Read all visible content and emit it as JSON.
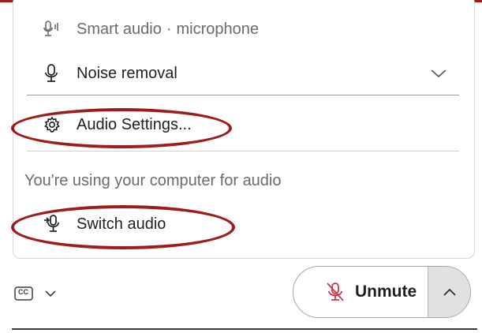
{
  "colors": {
    "highlight": "#a01c1c",
    "strip": "#a01c1c",
    "muted_icon": "#d0354a",
    "text_primary": "#1f1f1f",
    "text_secondary": "#6b6b6b"
  },
  "audio_menu": {
    "smart_audio": {
      "label": "Smart audio",
      "separator": "·",
      "mode": "microphone",
      "icon": "smart-microphone-icon"
    },
    "noise_removal": {
      "label": "Noise removal",
      "icon": "microphone-icon",
      "dropdown_icon": "chevron-down-icon"
    },
    "audio_settings": {
      "label": "Audio Settings...",
      "icon": "gear-icon"
    },
    "status_text": "You're using your computer for audio",
    "switch_audio": {
      "label": "Switch audio",
      "icon": "switch-audio-icon"
    }
  },
  "toolbar": {
    "captions": {
      "icon": "closed-captions-icon",
      "badge": "CC",
      "dropdown_icon": "chevron-down-icon"
    },
    "unmute": {
      "label": "Unmute",
      "icon": "muted-microphone-icon",
      "dropdown_icon": "chevron-up-icon"
    }
  }
}
